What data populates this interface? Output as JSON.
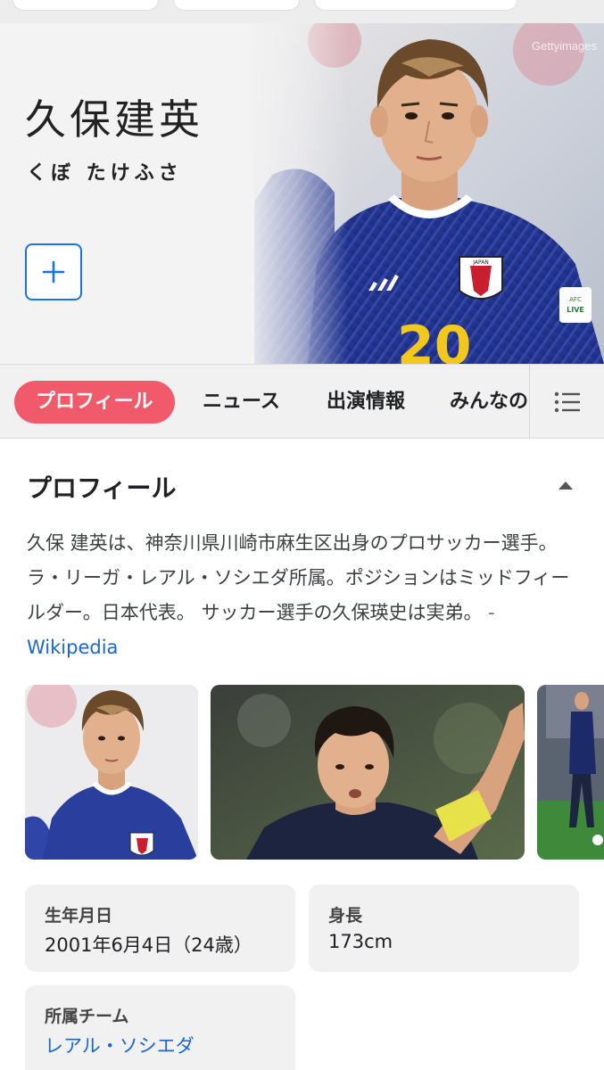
{
  "hero": {
    "name": "久保建英",
    "reading": "くぼ たけふさ",
    "watermark": "Gettyimages",
    "add_label": "+"
  },
  "tabs": [
    {
      "label": "プロフィール",
      "active": true
    },
    {
      "label": "ニュース",
      "active": false
    },
    {
      "label": "出演情報",
      "active": false
    },
    {
      "label": "みんなの",
      "active": false
    }
  ],
  "profile": {
    "title": "プロフィール",
    "description": "久保 建英は、神奈川県川崎市麻生区出身のプロサッカー選手。ラ・リーガ・レアル・ソシエダ所属。ポジションはミッドフィールダー。日本代表。 サッカー選手の久保瑛史は実弟。",
    "source_prefix": " - ",
    "source": "Wikipedia"
  },
  "info": {
    "birth": {
      "label": "生年月日",
      "value": "2001年6月4日（24歳）"
    },
    "height": {
      "label": "身長",
      "value": "173cm"
    },
    "team": {
      "label": "所属チーム",
      "value": "レアル・ソシエダ"
    }
  },
  "colors": {
    "accent_tab": "#f05a6a",
    "link": "#1967d2",
    "add_border": "#1a73e8"
  }
}
